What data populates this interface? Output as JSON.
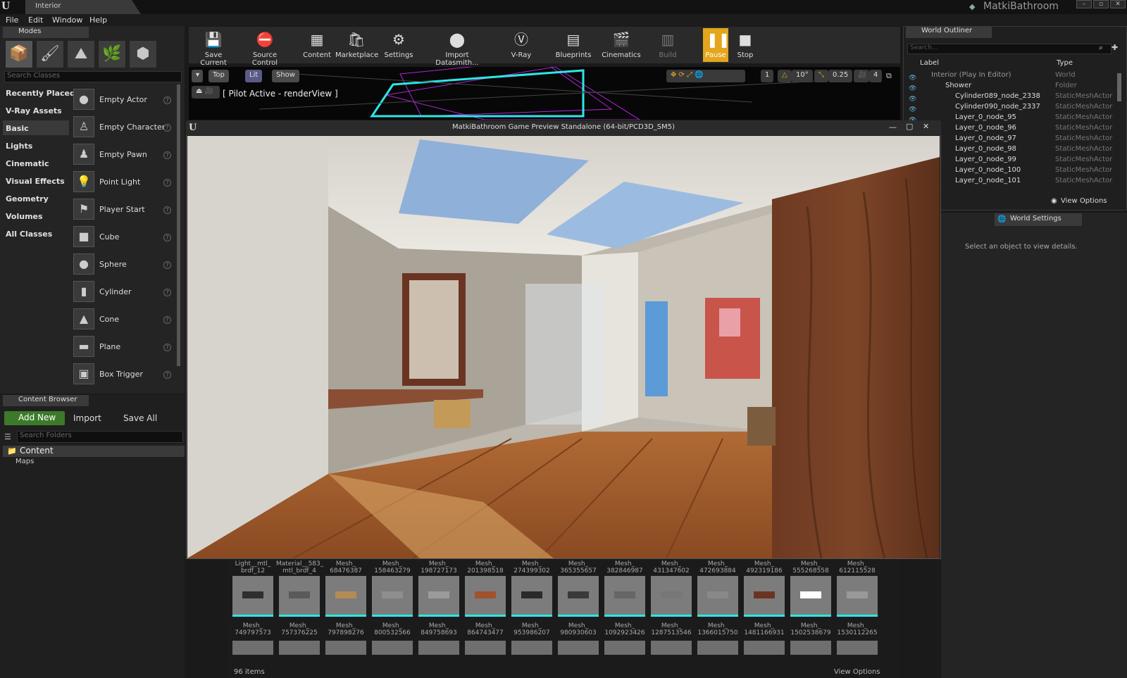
{
  "window": {
    "tab_title": "Interior",
    "project_name": "MatkiBathroom"
  },
  "menu": [
    "File",
    "Edit",
    "Window",
    "Help"
  ],
  "modes": {
    "tab_label": "Modes",
    "search_placeholder": "Search Classes",
    "categories": [
      "Recently Placed",
      "V-Ray Assets",
      "Basic",
      "Lights",
      "Cinematic",
      "Visual Effects",
      "Geometry",
      "Volumes",
      "All Classes"
    ],
    "selected_category": "Basic",
    "actors": [
      "Empty Actor",
      "Empty Character",
      "Empty Pawn",
      "Point Light",
      "Player Start",
      "Cube",
      "Sphere",
      "Cylinder",
      "Cone",
      "Plane",
      "Box Trigger"
    ]
  },
  "content_browser": {
    "tab_label": "Content Browser",
    "add_new": "Add New",
    "import": "Import",
    "save_all": "Save All",
    "search_placeholder": "Search Folders",
    "root": "Content",
    "child": "Maps",
    "item_count": "96 items",
    "view_options": "View Options"
  },
  "toolbar": [
    {
      "label": "Save Current",
      "icon": "save-icon"
    },
    {
      "label": "Source Control",
      "icon": "source-control-icon"
    },
    {
      "label": "Content",
      "icon": "content-icon"
    },
    {
      "label": "Marketplace",
      "icon": "marketplace-icon"
    },
    {
      "label": "Settings",
      "icon": "settings-icon"
    },
    {
      "label": "Import Datasmith...",
      "icon": "datasmith-icon"
    },
    {
      "label": "V-Ray",
      "icon": "vray-icon"
    },
    {
      "label": "Blueprints",
      "icon": "blueprints-icon"
    },
    {
      "label": "Cinematics",
      "icon": "cinematics-icon"
    },
    {
      "label": "Build",
      "icon": "build-icon"
    },
    {
      "label": "Pause",
      "icon": "pause-icon"
    },
    {
      "label": "Stop",
      "icon": "stop-icon"
    }
  ],
  "viewport": {
    "view_label": "Top",
    "lit_label": "Lit",
    "show_label": "Show",
    "pilot_text": "[ Pilot Active - renderView ]",
    "grid_value": "1",
    "angle_value": "10°",
    "scale_value": "0.25",
    "camera_speed": "4"
  },
  "game_window": {
    "title": "MatkiBathroom Game Preview Standalone (64-bit/PCD3D_SM5)"
  },
  "outliner": {
    "tab_label": "World Outliner",
    "search_placeholder": "Search...",
    "col_label": "Label",
    "col_type": "Type",
    "rows": [
      {
        "label": "Interior (Play In Editor)",
        "type": "World"
      },
      {
        "label": "Shower",
        "type": "Folder"
      },
      {
        "label": "Cylinder089_node_2338",
        "type": "StaticMeshActor"
      },
      {
        "label": "Cylinder090_node_2337",
        "type": "StaticMeshActor"
      },
      {
        "label": "Layer_0_node_95",
        "type": "StaticMeshActor"
      },
      {
        "label": "Layer_0_node_96",
        "type": "StaticMeshActor"
      },
      {
        "label": "Layer_0_node_97",
        "type": "StaticMeshActor"
      },
      {
        "label": "Layer_0_node_98",
        "type": "StaticMeshActor"
      },
      {
        "label": "Layer_0_node_99",
        "type": "StaticMeshActor"
      },
      {
        "label": "Layer_0_node_100",
        "type": "StaticMeshActor"
      },
      {
        "label": "Layer_0_node_101",
        "type": "StaticMeshActor"
      }
    ],
    "view_options": "View Options"
  },
  "details": {
    "tab_label": "World Settings",
    "empty_message": "Select an object to view details."
  },
  "assets_row_top": [
    "Light__mtl_ brdf_12",
    "Material__583_ mtl_brdf_4",
    "Mesh_ 68476387",
    "Mesh_ 158463279",
    "Mesh_ 198727173",
    "Mesh_ 201398518",
    "Mesh_ 274399302",
    "Mesh_ 365355657",
    "Mesh_ 382846987",
    "Mesh_ 431347602",
    "Mesh_ 472693884",
    "Mesh_ 492319186",
    "Mesh_ 555268558",
    "Mesh_ 612115528"
  ],
  "assets_row_bottom": [
    "Mesh_ 749797573",
    "Mesh_ 757376225",
    "Mesh_ 797898276",
    "Mesh_ 800532566",
    "Mesh_ 849758693",
    "Mesh_ 864743477",
    "Mesh_ 953986207",
    "Mesh_ 980930603",
    "Mesh_ 1092923426",
    "Mesh_ 1287513546",
    "Mesh_ 1366015750",
    "Mesh_ 1481166931",
    "Mesh_ 1502538679",
    "Mesh_ 1530112265"
  ]
}
